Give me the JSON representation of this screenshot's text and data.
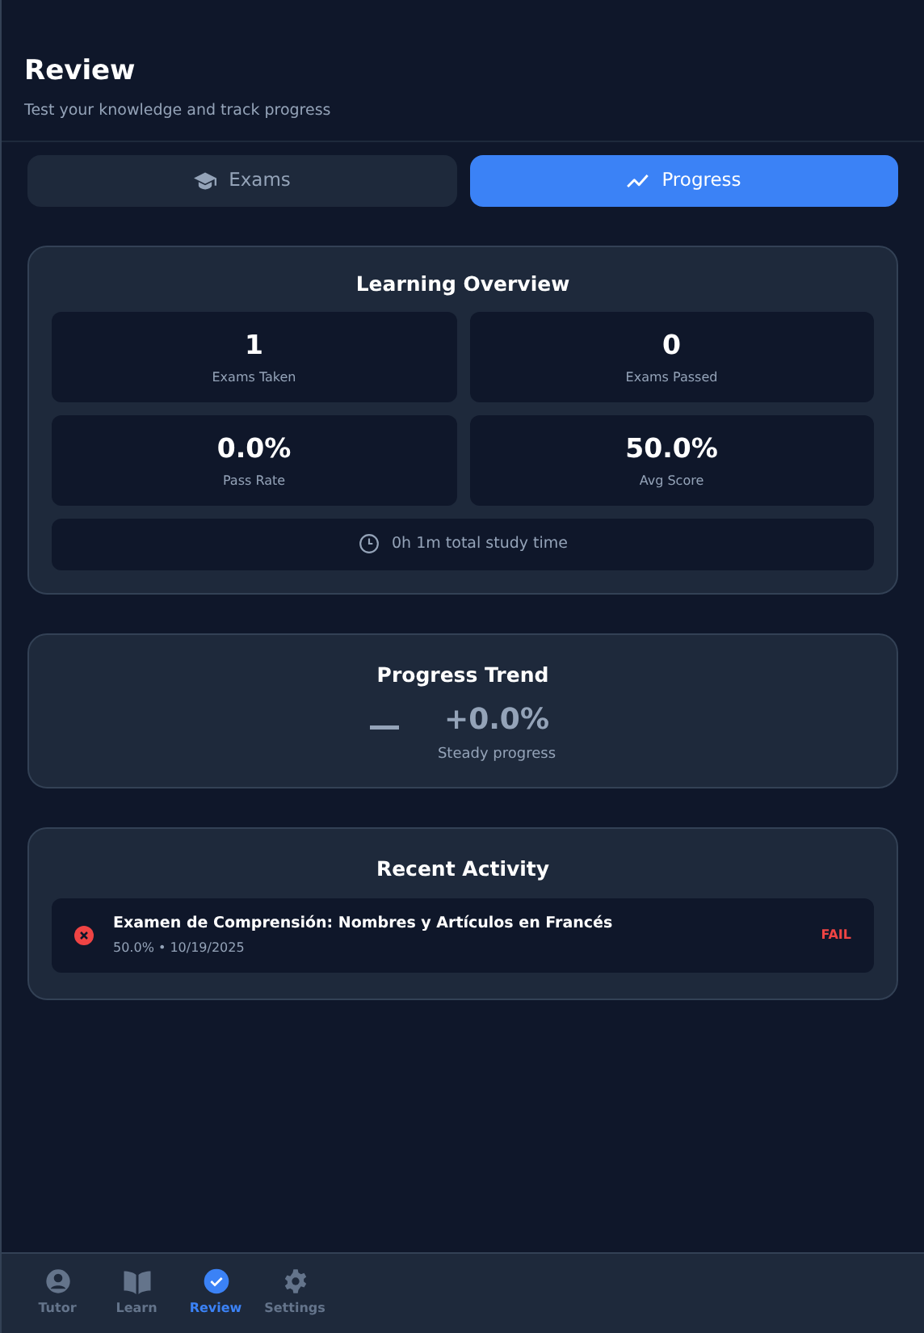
{
  "header": {
    "title": "Review",
    "subtitle": "Test your knowledge and track progress"
  },
  "tabs": [
    {
      "label": "Exams",
      "kind": "cap",
      "selected": false
    },
    {
      "label": "Progress",
      "kind": "trend",
      "selected": true
    }
  ],
  "overview": {
    "title": "Learning Overview",
    "stats": [
      {
        "value": "1",
        "label": "Exams Taken"
      },
      {
        "value": "0",
        "label": "Exams Passed"
      },
      {
        "value": "0.0%",
        "label": "Pass Rate"
      },
      {
        "value": "50.0%",
        "label": "Avg Score"
      }
    ],
    "study_time": "0h 1m total study time"
  },
  "trend": {
    "title": "Progress Trend",
    "kind": "flat",
    "change": "+0.0%",
    "caption": "Steady progress"
  },
  "recent_activity": {
    "title": "Recent Activity",
    "items": [
      {
        "title": "Examen de Comprensión: Nombres y Artículos en Francés",
        "meta": "50.0% • 10/19/2025",
        "passed": false,
        "result": "FAIL"
      }
    ]
  },
  "bottom_nav": [
    {
      "label": "Tutor",
      "kind": "user",
      "selected": false
    },
    {
      "label": "Learn",
      "kind": "book",
      "selected": false
    },
    {
      "label": "Review",
      "kind": "check",
      "selected": true
    },
    {
      "label": "Settings",
      "kind": "gear",
      "selected": false
    }
  ]
}
